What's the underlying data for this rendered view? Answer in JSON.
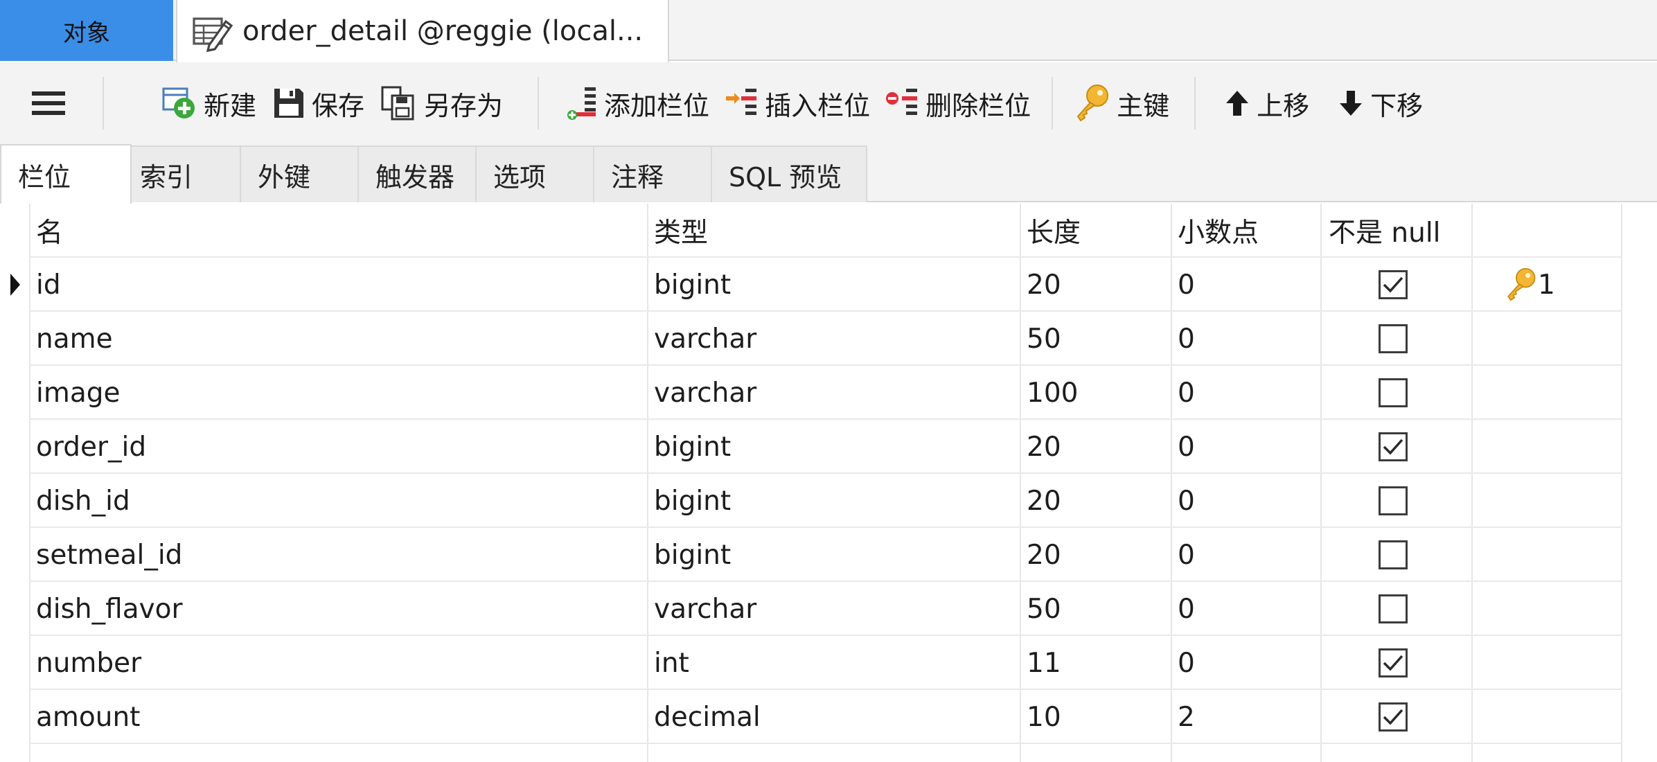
{
  "tabs": {
    "objects_label": "对象",
    "document_label": "order_detail @reggie (local..."
  },
  "toolbar": {
    "new_label": "新建",
    "save_label": "保存",
    "save_as_label": "另存为",
    "add_field_label": "添加栏位",
    "insert_field_label": "插入栏位",
    "delete_field_label": "删除栏位",
    "primary_key_label": "主键",
    "move_up_label": "上移",
    "move_down_label": "下移"
  },
  "subtabs": [
    "栏位",
    "索引",
    "外键",
    "触发器",
    "选项",
    "注释",
    "SQL 预览"
  ],
  "grid": {
    "columns": [
      "名",
      "类型",
      "长度",
      "小数点",
      "不是 null",
      ""
    ],
    "rows": [
      {
        "name": "id",
        "type": "bigint",
        "length": "20",
        "decimals": "0",
        "not_null": true,
        "key": "1",
        "current": true
      },
      {
        "name": "name",
        "type": "varchar",
        "length": "50",
        "decimals": "0",
        "not_null": false,
        "key": "",
        "current": false
      },
      {
        "name": "image",
        "type": "varchar",
        "length": "100",
        "decimals": "0",
        "not_null": false,
        "key": "",
        "current": false
      },
      {
        "name": "order_id",
        "type": "bigint",
        "length": "20",
        "decimals": "0",
        "not_null": true,
        "key": "",
        "current": false
      },
      {
        "name": "dish_id",
        "type": "bigint",
        "length": "20",
        "decimals": "0",
        "not_null": false,
        "key": "",
        "current": false
      },
      {
        "name": "setmeal_id",
        "type": "bigint",
        "length": "20",
        "decimals": "0",
        "not_null": false,
        "key": "",
        "current": false
      },
      {
        "name": "dish_flavor",
        "type": "varchar",
        "length": "50",
        "decimals": "0",
        "not_null": false,
        "key": "",
        "current": false
      },
      {
        "name": "number",
        "type": "int",
        "length": "11",
        "decimals": "0",
        "not_null": true,
        "key": "",
        "current": false
      },
      {
        "name": "amount",
        "type": "decimal",
        "length": "10",
        "decimals": "2",
        "not_null": true,
        "key": "",
        "current": false
      }
    ]
  },
  "colors": {
    "objects_tab": "#3b8ee8",
    "key_icon": "#f2b632",
    "add_icon": "#3aa83a",
    "delete_icon": "#e0303a",
    "insert_icon": "#f08a1c"
  }
}
